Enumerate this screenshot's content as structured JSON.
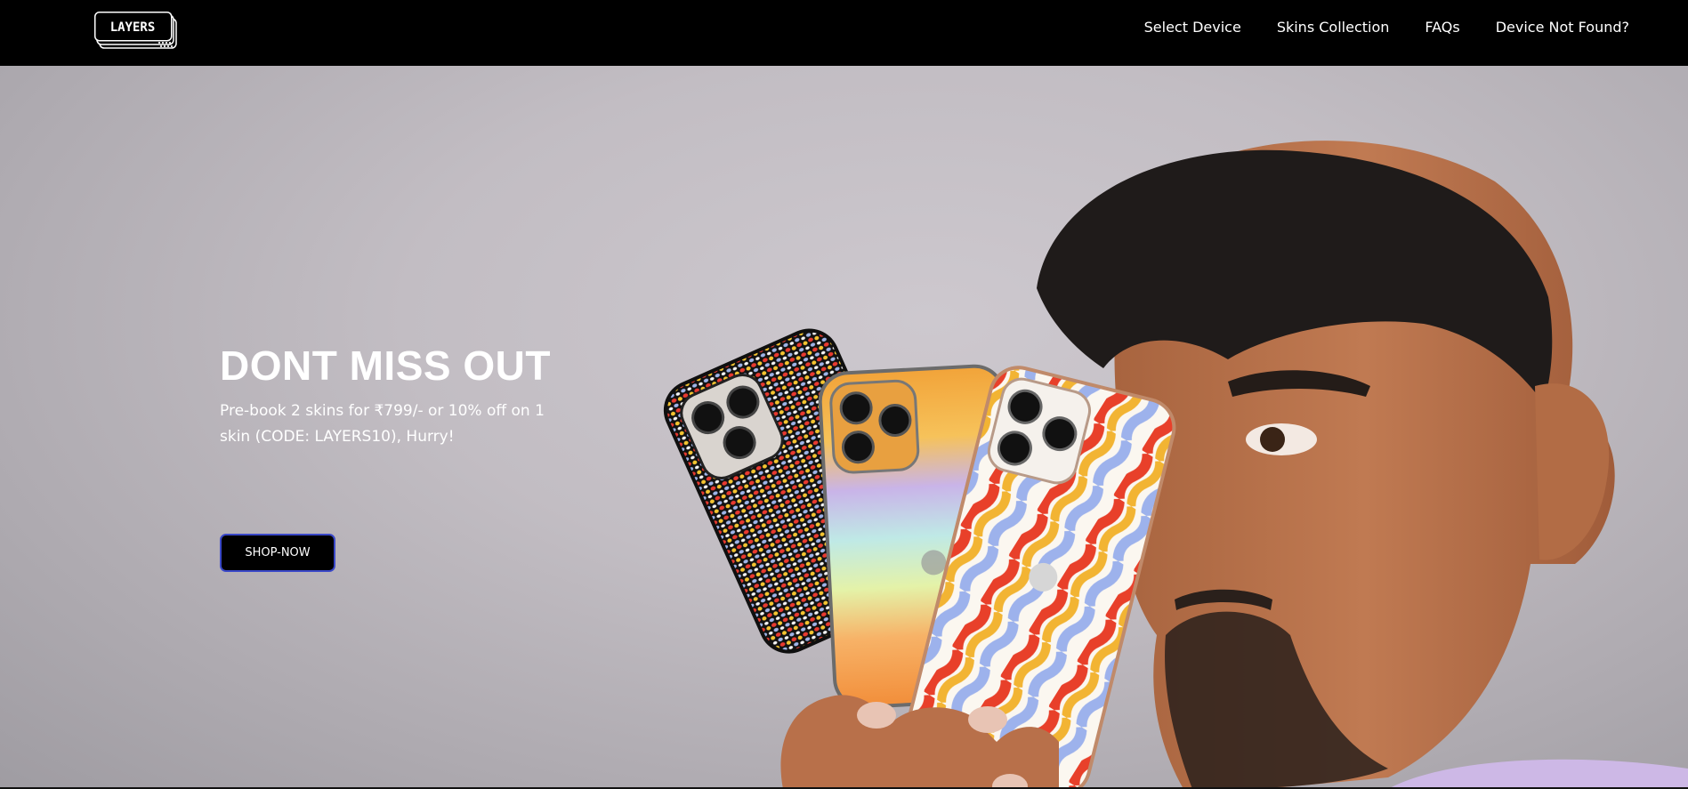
{
  "brand": {
    "logo_text": "LAYERS",
    "logo_icon": "layers-logo-icon"
  },
  "nav": {
    "items": [
      {
        "label": "Select Device"
      },
      {
        "label": "Skins Collection"
      },
      {
        "label": "FAQs"
      },
      {
        "label": "Device Not Found?"
      }
    ]
  },
  "hero": {
    "title": "DONT MISS OUT",
    "subtitle": "Pre-book 2 skins for ₹799/- or 10% off on 1 skin (CODE: LAYERS10), Hurry!",
    "cta_label": "SHOP-NOW",
    "image_subject": "man-holding-three-skinned-phones"
  },
  "colors": {
    "nav_bg": "#000000",
    "hero_bg": "#c4bfc5",
    "cta_bg": "#000000",
    "cta_border": "#3a48c8",
    "text": "#ffffff"
  }
}
